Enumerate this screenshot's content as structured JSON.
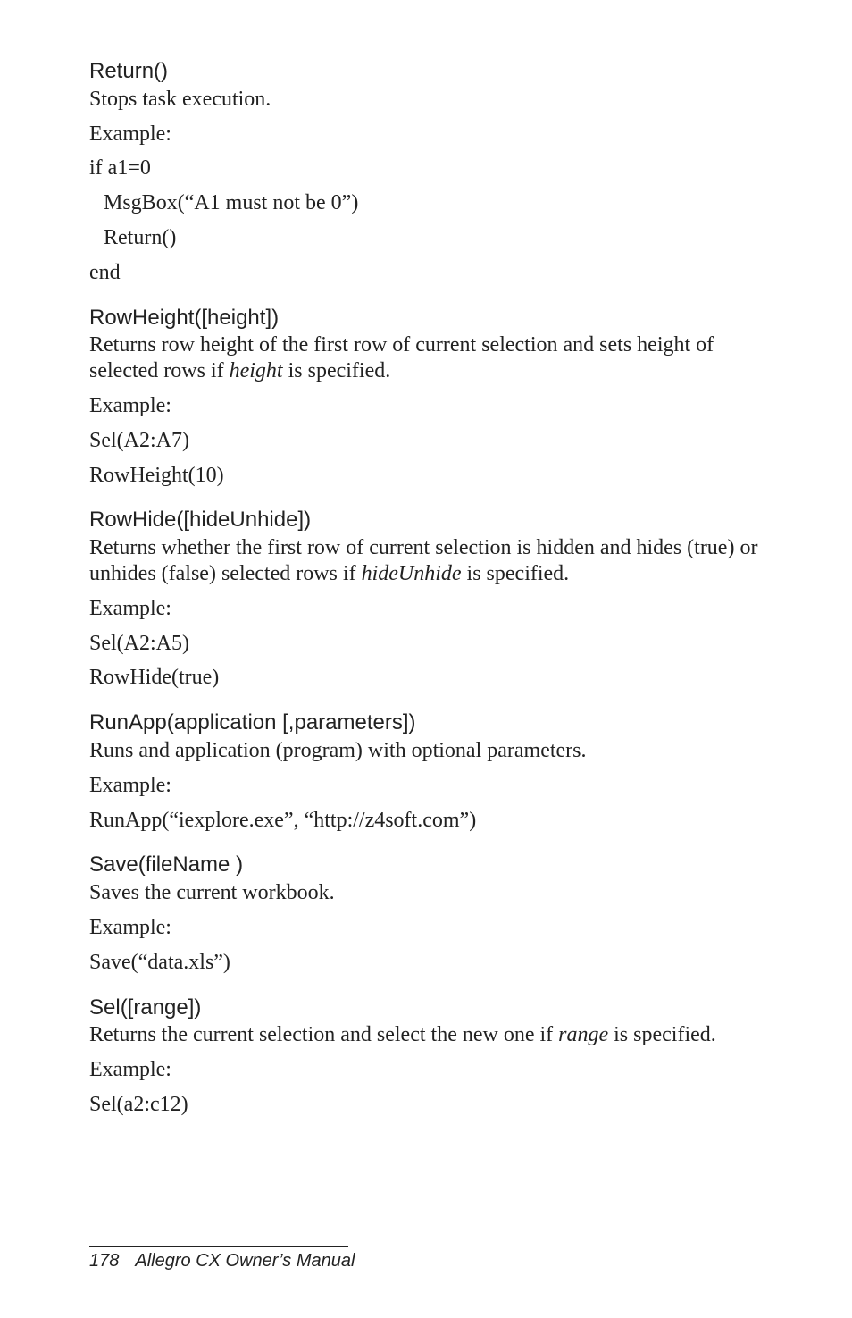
{
  "sections": [
    {
      "heading": "Return()",
      "lines": [
        {
          "text": "Stops task execution."
        },
        {
          "text": "Example:"
        },
        {
          "text": "if a1=0"
        },
        {
          "text": "MsgBox(“A1 must not be 0”)",
          "indent": true
        },
        {
          "text": "Return()",
          "indent": true
        },
        {
          "text": "end"
        }
      ]
    },
    {
      "heading": "RowHeight([height])",
      "lines": [
        {
          "html": "Returns row height of  the first row of current selection and sets height of selected rows if <em>height</em> is specified."
        },
        {
          "text": "Example:"
        },
        {
          "text": "Sel(A2:A7)"
        },
        {
          "text": "RowHeight(10)"
        }
      ]
    },
    {
      "heading": "RowHide([hideUnhide])",
      "lines": [
        {
          "html": "Returns whether the first row of current selection  is hidden and hides (true) or unhides (false) selected rows if <em>hideUnhide</em> is specified."
        },
        {
          "text": "Example:"
        },
        {
          "text": "Sel(A2:A5)"
        },
        {
          "text": "RowHide(true)"
        }
      ]
    },
    {
      "heading": "RunApp(application [,parameters])",
      "lines": [
        {
          "text": "Runs and application (program) with optional parameters."
        },
        {
          "text": "Example:"
        },
        {
          "text": "RunApp(“iexplore.exe”, “http://z4soft.com”)"
        }
      ]
    },
    {
      "heading": "Save(fileName )",
      "lines": [
        {
          "text": "Saves the current workbook."
        },
        {
          "text": "Example:"
        },
        {
          "text": "Save(“data.xls”)"
        }
      ]
    },
    {
      "heading": "Sel([range])",
      "lines": [
        {
          "html": "Returns the current selection and select the new one if <em>range</em> is specified."
        },
        {
          "text": "Example:"
        },
        {
          "text": "Sel(a2:c12)"
        }
      ]
    }
  ],
  "footer": {
    "page": "178",
    "title": "Allegro CX Owner’s Manual"
  }
}
